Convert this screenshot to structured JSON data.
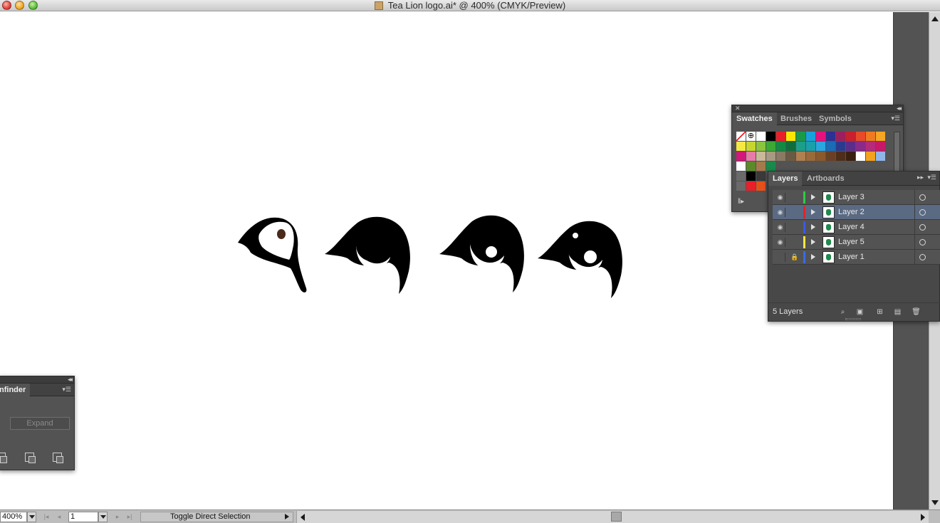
{
  "window": {
    "title": "Tea Lion logo.ai* @ 400% (CMYK/Preview)"
  },
  "swatches_panel": {
    "tabs": [
      "Swatches",
      "Brushes",
      "Symbols"
    ],
    "active_tab": "Swatches",
    "rows": [
      [
        "#ffffff",
        "#ffffff",
        "#ffffff",
        "#000000",
        "#e8202a",
        "#ffe600",
        "#1a9a48",
        "#16a3dc",
        "#e6127c",
        "#2d3192",
        "#9b1f5e",
        "#c8202e",
        "#e84a2a",
        "#f07a22",
        "#f6a623"
      ],
      [
        "#f4e842",
        "#c7d62e",
        "#8cc43f",
        "#3aaa35",
        "#128a44",
        "#0f6e3c",
        "#1b9e8a",
        "#1aa0a8",
        "#2aa7e0",
        "#1a6cb4",
        "#2a3b8f",
        "#5a2d8a",
        "#8a2a8a",
        "#b52a7a",
        "#c8186a"
      ],
      [
        "#d2187a",
        "#e87aa8",
        "#c9b89a",
        "#a69a82",
        "#8a7a64",
        "#6a5a44",
        "#b08050",
        "#9a6a3a",
        "#8a5a2c",
        "#6a4024",
        "#4e2e18",
        "#3a2010",
        "#ffffff",
        "#f2a21e",
        "#8fb6e8"
      ],
      [
        "#ffffff",
        "#5a8a2a",
        "#a67a4a",
        "#1a8a4a",
        "#535353",
        "#535353",
        "#535353",
        "#535353",
        "#535353",
        "#535353",
        "#535353",
        "#535353",
        "#535353",
        "#535353",
        "#535353"
      ],
      [
        "#6a6a6a",
        "#000000",
        "#3a3a3a",
        "#535353",
        "#535353",
        "#535353",
        "#535353",
        "#535353",
        "#535353",
        "#535353",
        "#535353",
        "#535353",
        "#535353",
        "#535353",
        "#535353"
      ],
      [
        "#6a6a6a",
        "#e8202a",
        "#e8501a",
        "#535353",
        "#535353",
        "#535353",
        "#535353",
        "#535353",
        "#535353",
        "#535353",
        "#535353",
        "#535353",
        "#535353",
        "#535353",
        "#535353"
      ]
    ],
    "library_icon": "swatch-libraries-icon"
  },
  "layers_panel": {
    "tabs": [
      "Layers",
      "Artboards"
    ],
    "active_tab": "Layers",
    "layers": [
      {
        "name": "Layer 3",
        "visible": true,
        "locked": false,
        "color": "#2ecc40",
        "selected": false
      },
      {
        "name": "Layer 2",
        "visible": true,
        "locked": false,
        "color": "#e8202a",
        "selected": true
      },
      {
        "name": "Layer 4",
        "visible": true,
        "locked": false,
        "color": "#3a5ae8",
        "selected": false
      },
      {
        "name": "Layer 5",
        "visible": true,
        "locked": false,
        "color": "#f6e642",
        "selected": false
      },
      {
        "name": "Layer 1",
        "visible": false,
        "locked": true,
        "color": "#3a6ae8",
        "selected": false
      }
    ],
    "count_label": "5 Layers"
  },
  "pathfinder_panel": {
    "tab_label": "nfinder",
    "expand_label": "Expand"
  },
  "statusbar": {
    "zoom": "400%",
    "artboard": "1",
    "status_text": "Toggle Direct Selection"
  }
}
